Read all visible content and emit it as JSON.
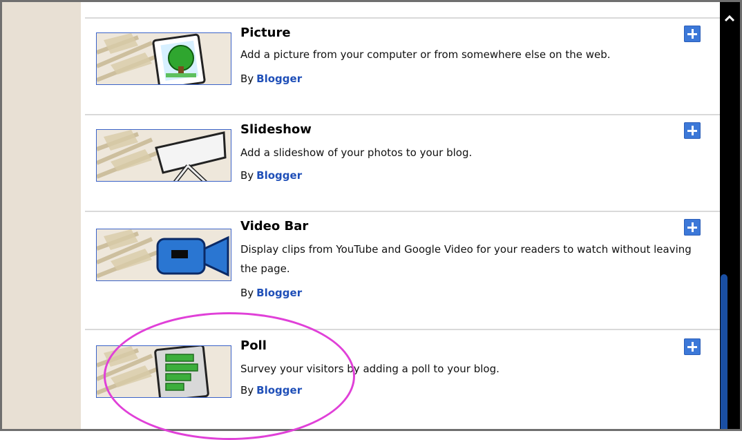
{
  "gadgets": [
    {
      "title": "Picture",
      "description": "Add a picture from your computer or from somewhere else on the web.",
      "by_label": "By",
      "author": "Blogger",
      "icon": "picture-icon"
    },
    {
      "title": "Slideshow",
      "description": "Add a slideshow of your photos to your blog.",
      "by_label": "By",
      "author": "Blogger",
      "icon": "slideshow-icon"
    },
    {
      "title": "Video Bar",
      "description": "Display clips from YouTube and Google Video for your readers to watch without leaving the page.",
      "by_label": "By",
      "author": "Blogger",
      "icon": "video-camera-icon"
    },
    {
      "title": "Poll",
      "description": "Survey your visitors by adding a poll to your blog.",
      "by_label": "By",
      "author": "Blogger",
      "icon": "poll-icon"
    }
  ],
  "colors": {
    "author_link": "#1f4fb8",
    "add_button": "#3c78d8",
    "highlight": "#e040d8",
    "thumb_border": "#3a62c8"
  }
}
